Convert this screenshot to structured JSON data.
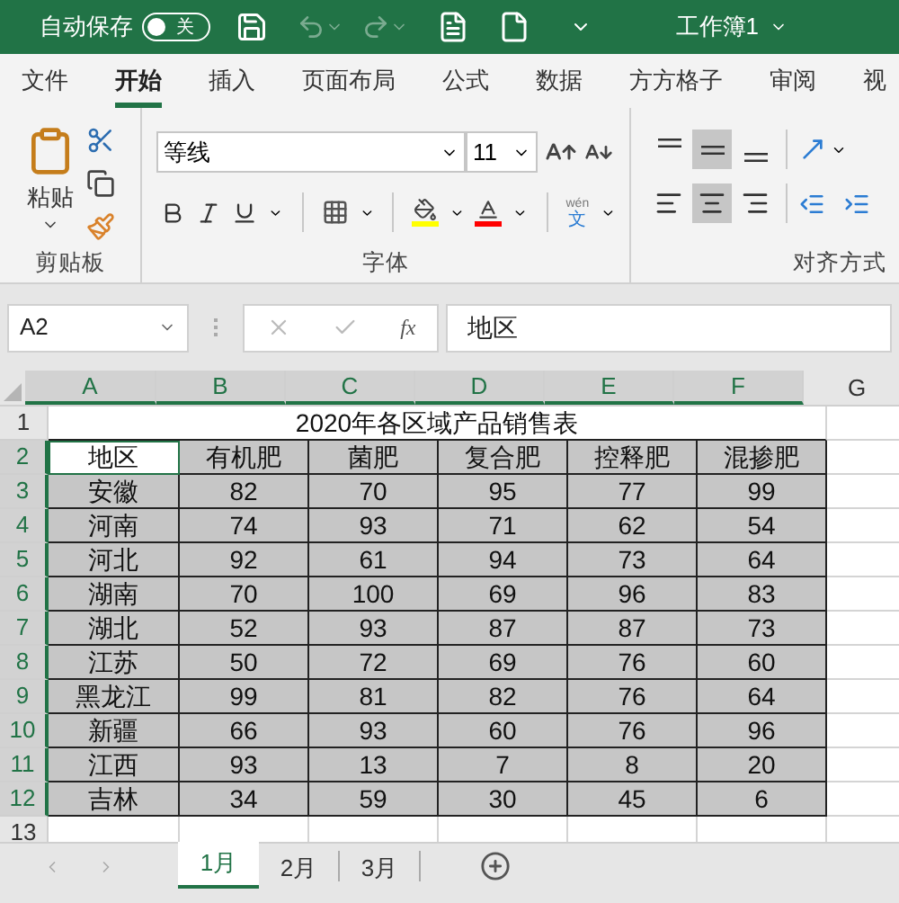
{
  "title_bar": {
    "autosave_label": "自动保存",
    "autosave": {
      "on": false,
      "label": "关"
    },
    "workbook": "工作簿1"
  },
  "ribbon_tabs": [
    {
      "label": "文件",
      "selected": false
    },
    {
      "label": "开始",
      "selected": true
    },
    {
      "label": "插入",
      "selected": false
    },
    {
      "label": "页面布局",
      "selected": false
    },
    {
      "label": "公式",
      "selected": false
    },
    {
      "label": "数据",
      "selected": false
    },
    {
      "label": "方方格子",
      "selected": false
    },
    {
      "label": "审阅",
      "selected": false
    },
    {
      "label": "视",
      "selected": false
    }
  ],
  "clipboard": {
    "paste": "粘贴",
    "group": "剪贴板"
  },
  "font": {
    "name": "等线",
    "size": "11",
    "pinyin": "wén",
    "pinyin_char": "文",
    "group": "字体"
  },
  "alignment": {
    "group": "对齐方式",
    "top_row": [
      {
        "kind": "top",
        "selected": false
      },
      {
        "kind": "middle",
        "selected": true
      },
      {
        "kind": "bottom",
        "selected": false
      }
    ],
    "bottom_row": [
      {
        "kind": "left",
        "selected": false
      },
      {
        "kind": "center",
        "selected": true
      },
      {
        "kind": "right",
        "selected": false
      }
    ]
  },
  "formula_bar": {
    "name_box": "A2",
    "fx": "fx",
    "value": "地区"
  },
  "columns": [
    {
      "label": "A",
      "selected": true
    },
    {
      "label": "B",
      "selected": true
    },
    {
      "label": "C",
      "selected": true
    },
    {
      "label": "D",
      "selected": true
    },
    {
      "label": "E",
      "selected": true
    },
    {
      "label": "F",
      "selected": true
    },
    {
      "label": "G",
      "selected": false
    }
  ],
  "rows": [
    {
      "number": "1",
      "selected": false,
      "kind": "title",
      "cells": [
        "2020年各区域产品销售表"
      ]
    },
    {
      "number": "2",
      "selected": true,
      "kind": "data",
      "first_cell_active": true,
      "cells": [
        "地区",
        "有机肥",
        "菌肥",
        "复合肥",
        "控释肥",
        "混掺肥"
      ]
    },
    {
      "number": "3",
      "selected": true,
      "kind": "data",
      "cells": [
        "安徽",
        "82",
        "70",
        "95",
        "77",
        "99"
      ]
    },
    {
      "number": "4",
      "selected": true,
      "kind": "data",
      "cells": [
        "河南",
        "74",
        "93",
        "71",
        "62",
        "54"
      ]
    },
    {
      "number": "5",
      "selected": true,
      "kind": "data",
      "cells": [
        "河北",
        "92",
        "61",
        "94",
        "73",
        "64"
      ]
    },
    {
      "number": "6",
      "selected": true,
      "kind": "data",
      "cells": [
        "湖南",
        "70",
        "100",
        "69",
        "96",
        "83"
      ]
    },
    {
      "number": "7",
      "selected": true,
      "kind": "data",
      "cells": [
        "湖北",
        "52",
        "93",
        "87",
        "87",
        "73"
      ]
    },
    {
      "number": "8",
      "selected": true,
      "kind": "data",
      "cells": [
        "江苏",
        "50",
        "72",
        "69",
        "76",
        "60"
      ]
    },
    {
      "number": "9",
      "selected": true,
      "kind": "data",
      "cells": [
        "黑龙江",
        "99",
        "81",
        "82",
        "76",
        "64"
      ]
    },
    {
      "number": "10",
      "selected": true,
      "kind": "data",
      "cells": [
        "新疆",
        "66",
        "93",
        "60",
        "76",
        "96"
      ]
    },
    {
      "number": "11",
      "selected": true,
      "kind": "data",
      "cells": [
        "江西",
        "93",
        "13",
        "7",
        "8",
        "20"
      ]
    },
    {
      "number": "12",
      "selected": true,
      "kind": "data",
      "cells": [
        "吉林",
        "34",
        "59",
        "30",
        "45",
        "6"
      ]
    },
    {
      "number": "13",
      "selected": false,
      "kind": "empty",
      "cells": []
    }
  ],
  "sheet_tabs": [
    {
      "label": "1月",
      "selected": true
    },
    {
      "label": "2月",
      "selected": false
    },
    {
      "label": "3月",
      "selected": false
    }
  ]
}
